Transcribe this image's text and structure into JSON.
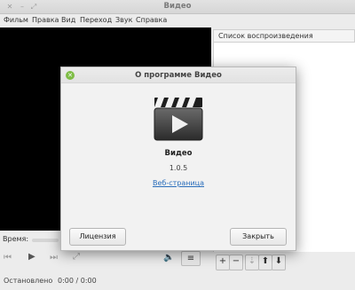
{
  "window": {
    "title": "Видео",
    "controls": {
      "close_icon": "close-icon",
      "minimize_icon": "minimize-icon",
      "maximize_icon": "maximize-icon"
    }
  },
  "menubar": {
    "items": [
      "Фильм",
      "Правка",
      "Вид",
      "Переход",
      "Звук",
      "Справка"
    ]
  },
  "playlist": {
    "header": "Список воспроизведения",
    "toolbar": [
      "+",
      "−",
      "⇣",
      "⬆",
      "⬇"
    ]
  },
  "player": {
    "time_label": "Время:",
    "status": "Остановлено",
    "time": "0:00 / 0:00",
    "menu_button": "≡"
  },
  "dialog": {
    "title": "О программе Видео",
    "app_name": "Видео",
    "version": "1.0.5",
    "link": "Веб-страница",
    "license_button": "Лицензия",
    "close_button": "Закрыть"
  },
  "colors": {
    "video_bg": "#000000",
    "link": "#2a6ebb",
    "close_dot": "#7ebd45"
  }
}
